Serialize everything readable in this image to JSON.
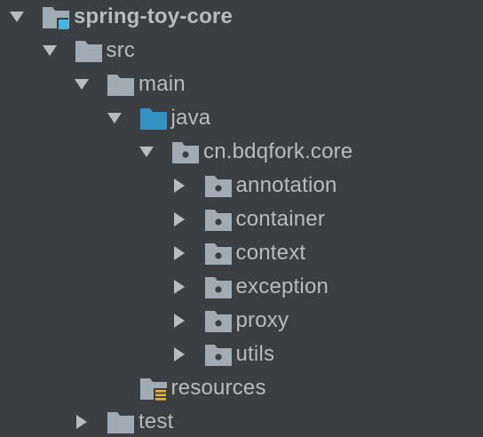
{
  "project_tree": {
    "nodes": [
      {
        "label": "spring-toy-core",
        "depth": 0,
        "arrow": "expanded",
        "icon": "module-folder-icon",
        "bold": true
      },
      {
        "label": "src",
        "depth": 1,
        "arrow": "expanded",
        "icon": "folder-icon",
        "bold": false
      },
      {
        "label": "main",
        "depth": 2,
        "arrow": "expanded",
        "icon": "folder-icon",
        "bold": false
      },
      {
        "label": "java",
        "depth": 3,
        "arrow": "expanded",
        "icon": "source-root-folder-icon",
        "bold": false
      },
      {
        "label": "cn.bdqfork.core",
        "depth": 4,
        "arrow": "expanded",
        "icon": "package-icon",
        "bold": false
      },
      {
        "label": "annotation",
        "depth": 5,
        "arrow": "collapsed",
        "icon": "package-icon",
        "bold": false
      },
      {
        "label": "container",
        "depth": 5,
        "arrow": "collapsed",
        "icon": "package-icon",
        "bold": false
      },
      {
        "label": "context",
        "depth": 5,
        "arrow": "collapsed",
        "icon": "package-icon",
        "bold": false
      },
      {
        "label": "exception",
        "depth": 5,
        "arrow": "collapsed",
        "icon": "package-icon",
        "bold": false
      },
      {
        "label": "proxy",
        "depth": 5,
        "arrow": "collapsed",
        "icon": "package-icon",
        "bold": false
      },
      {
        "label": "utils",
        "depth": 5,
        "arrow": "collapsed",
        "icon": "package-icon",
        "bold": false
      },
      {
        "label": "resources",
        "depth": 3,
        "arrow": "none",
        "icon": "resources-folder-icon",
        "bold": false
      },
      {
        "label": "test",
        "depth": 2,
        "arrow": "collapsed",
        "icon": "folder-icon",
        "bold": false
      }
    ]
  },
  "colors": {
    "background": "#3c3f41",
    "text": "#bbbbbb",
    "arrow": "#bbbbbb",
    "folder": "#a0abb3",
    "source_root_folder": "#3592c4",
    "module_marker": "#40b6e0",
    "resources_marker": "#e8b237",
    "package_dot": "#3c3f41"
  }
}
